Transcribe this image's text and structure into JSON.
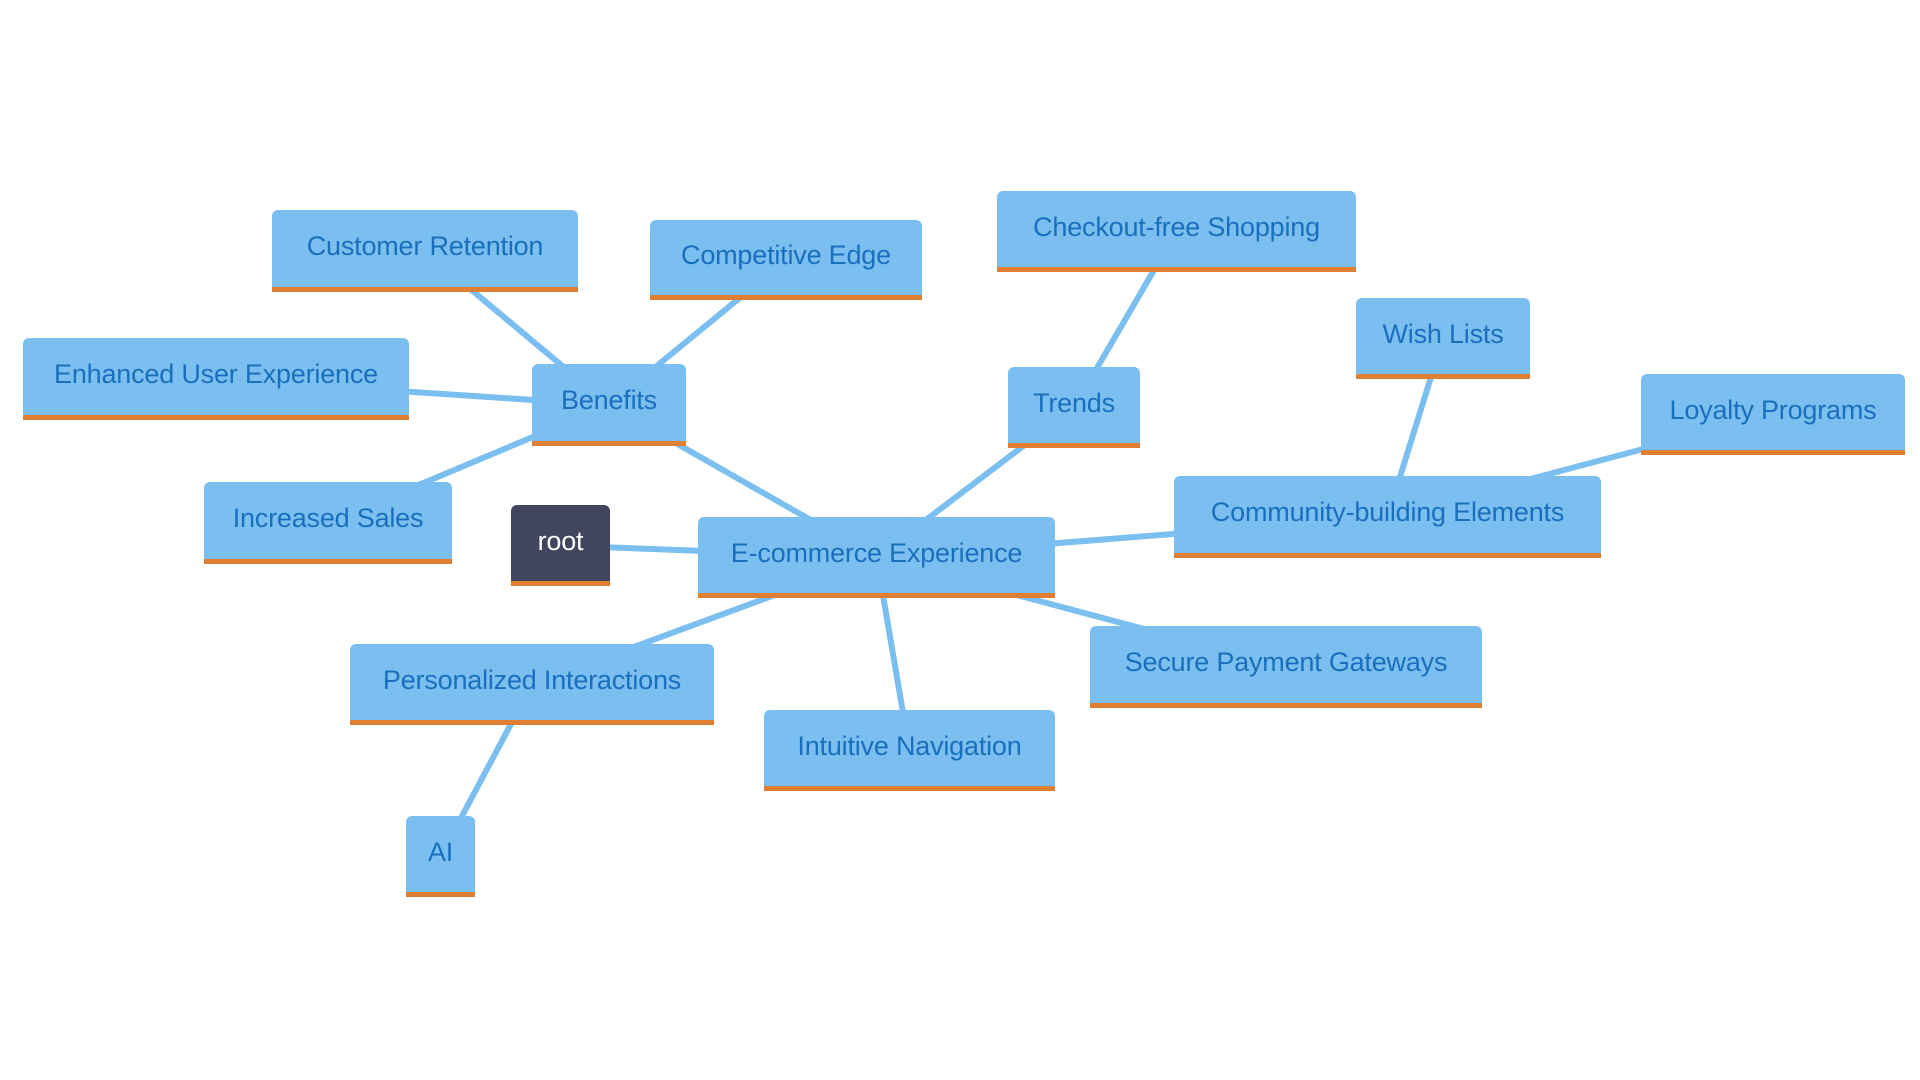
{
  "diagram": {
    "type": "mindmap",
    "colors": {
      "node_fill": "#7bbff0",
      "node_text": "#1a6fbd",
      "node_underline": "#e07e32",
      "root_fill": "#41455e",
      "root_text": "#ffffff",
      "edge": "#7bbff0",
      "background": "#ffffff"
    },
    "nodes": {
      "root": {
        "label": "root"
      },
      "ecommerce": {
        "label": "E-commerce Experience"
      },
      "benefits": {
        "label": "Benefits"
      },
      "customer_retention": {
        "label": "Customer Retention"
      },
      "competitive_edge": {
        "label": "Competitive Edge"
      },
      "enhanced_ux": {
        "label": "Enhanced User Experience"
      },
      "increased_sales": {
        "label": "Increased Sales"
      },
      "trends": {
        "label": "Trends"
      },
      "checkout_free": {
        "label": "Checkout-free Shopping"
      },
      "community": {
        "label": "Community-building Elements"
      },
      "wish_lists": {
        "label": "Wish Lists"
      },
      "loyalty": {
        "label": "Loyalty Programs"
      },
      "secure_payment": {
        "label": "Secure Payment Gateways"
      },
      "intuitive_nav": {
        "label": "Intuitive Navigation"
      },
      "personalized": {
        "label": "Personalized Interactions"
      },
      "ai": {
        "label": "AI"
      }
    },
    "edges": [
      {
        "from": "root",
        "to": "ecommerce"
      },
      {
        "from": "ecommerce",
        "to": "benefits"
      },
      {
        "from": "benefits",
        "to": "customer_retention"
      },
      {
        "from": "benefits",
        "to": "competitive_edge"
      },
      {
        "from": "benefits",
        "to": "enhanced_ux"
      },
      {
        "from": "benefits",
        "to": "increased_sales"
      },
      {
        "from": "ecommerce",
        "to": "trends"
      },
      {
        "from": "trends",
        "to": "checkout_free"
      },
      {
        "from": "ecommerce",
        "to": "community"
      },
      {
        "from": "community",
        "to": "wish_lists"
      },
      {
        "from": "community",
        "to": "loyalty"
      },
      {
        "from": "ecommerce",
        "to": "secure_payment"
      },
      {
        "from": "ecommerce",
        "to": "intuitive_nav"
      },
      {
        "from": "ecommerce",
        "to": "personalized"
      },
      {
        "from": "personalized",
        "to": "ai"
      }
    ]
  }
}
